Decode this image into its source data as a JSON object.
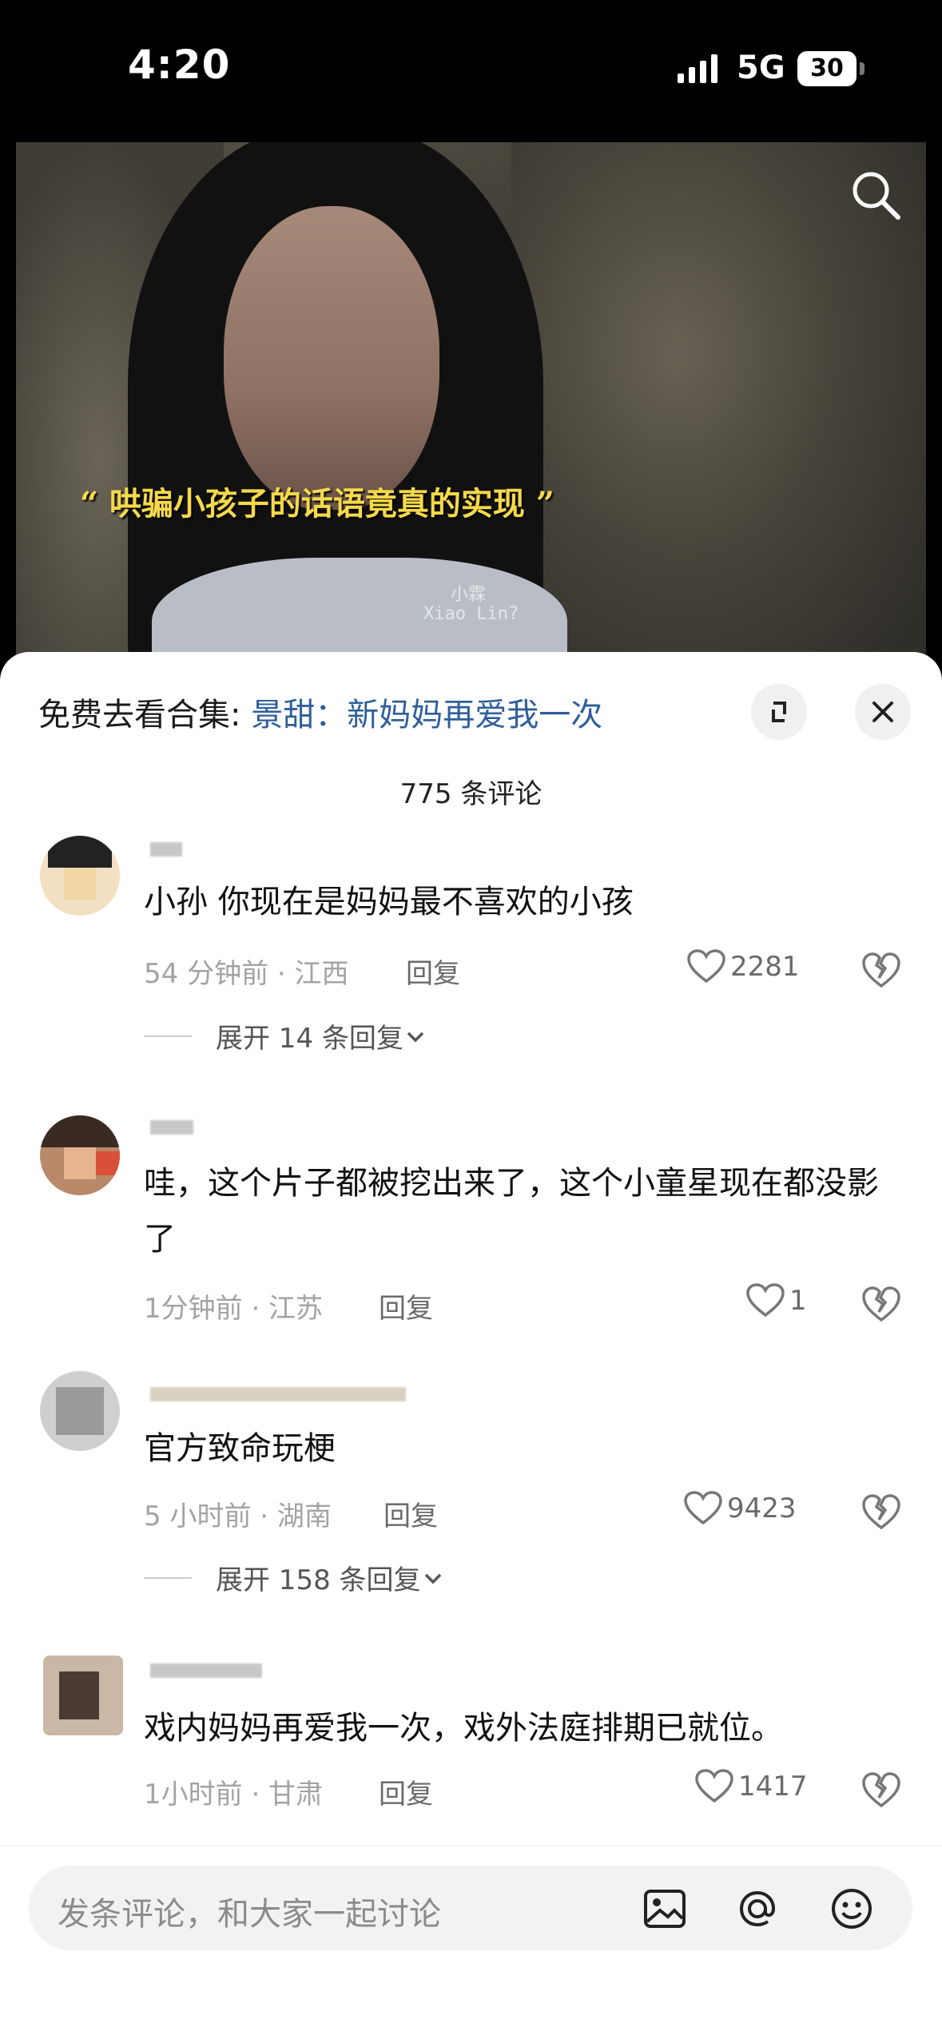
{
  "status": {
    "time": "4:20",
    "network": "5G",
    "battery": "30"
  },
  "video": {
    "caption": "“ 哄骗小孩子的话语竟真的实现 ”",
    "subtitle_cn": "小霖",
    "subtitle_en": "Xiao Lin?"
  },
  "sheet": {
    "collection_prefix": "免费去看合集: ",
    "collection_link": "景甜：新妈妈再爱我一次",
    "comment_count": "775 条评论"
  },
  "comments": [
    {
      "text": "小孙 你现在是妈妈最不喜欢的小孩",
      "time_location": "54 分钟前 · 江西",
      "reply": "回复",
      "likes": "2281",
      "expand": "展开 14 条回复"
    },
    {
      "text": "哇，这个片子都被挖出来了，这个小童星现在都没影了",
      "time_location": "1分钟前 · 江苏",
      "reply": "回复",
      "likes": "1"
    },
    {
      "text": "官方致命玩梗",
      "time_location": "5 小时前 · 湖南",
      "reply": "回复",
      "likes": "9423",
      "expand": "展开 158 条回复"
    },
    {
      "text": "戏内妈妈再爱我一次，戏外法庭排期已就位。",
      "time_location": "1小时前 · 甘肃",
      "reply": "回复",
      "likes": "1417"
    }
  ],
  "input": {
    "placeholder": "发条评论，和大家一起讨论"
  },
  "icons": {
    "signal": "signal-icon",
    "search": "search-icon",
    "expand": "expand-icon",
    "close": "close-icon",
    "heart": "heart-icon",
    "dislike": "broken-heart-icon",
    "chevron": "chevron-down-icon",
    "image": "image-icon",
    "mention": "at-icon",
    "emoji": "emoji-icon"
  }
}
